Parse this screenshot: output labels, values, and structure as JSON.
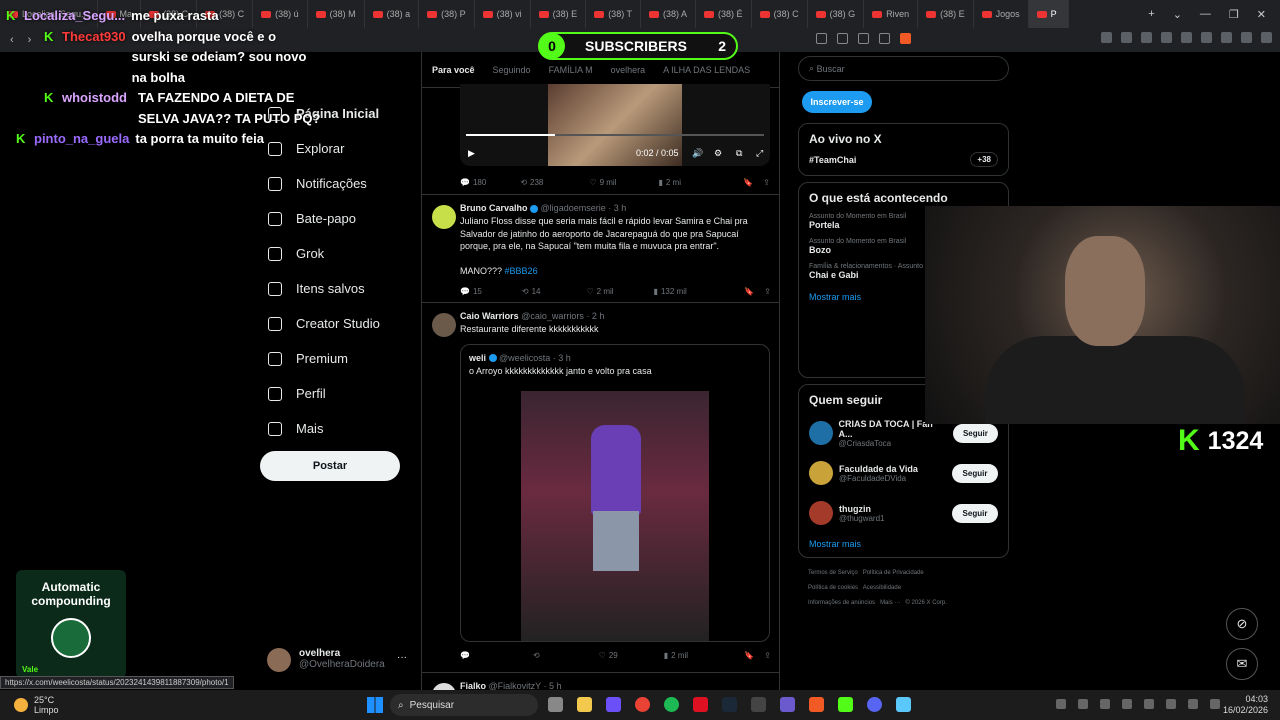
{
  "browser": {
    "tabs": [
      {
        "label": "Localiza_Segu...",
        "active": false
      },
      {
        "label": "Ma",
        "active": false
      },
      {
        "label": "(38) C",
        "active": false
      },
      {
        "label": "(38) C",
        "active": false
      },
      {
        "label": "(38) ú",
        "active": false
      },
      {
        "label": "(38) M",
        "active": false
      },
      {
        "label": "(38) a",
        "active": false
      },
      {
        "label": "(38) P",
        "active": false
      },
      {
        "label": "(38) vi",
        "active": false
      },
      {
        "label": "(38) E",
        "active": false
      },
      {
        "label": "(38) T",
        "active": false
      },
      {
        "label": "(38) A",
        "active": false
      },
      {
        "label": "(38) É",
        "active": false
      },
      {
        "label": "(38) C",
        "active": false
      },
      {
        "label": "(38) G",
        "active": false
      },
      {
        "label": "Riven",
        "active": false
      },
      {
        "label": "(38) E",
        "active": false
      },
      {
        "label": "Jogos",
        "active": false
      },
      {
        "label": "P",
        "active": true
      }
    ],
    "window_controls": [
      "+",
      "⌄",
      "—",
      "❐",
      "✕"
    ],
    "status_url": "https://x.com/weelicosta/status/2023241439811887309/photo/1"
  },
  "overlay": {
    "subscribers_count_left": "0",
    "subscribers_label": "SUBSCRIBERS",
    "subscribers_count_right": "2",
    "chat": [
      {
        "user": "Localiza_Segu...",
        "message": "me puxa rasta"
      },
      {
        "user": "Thecat930",
        "message": "ovelha porque você e o surski se odeiam? sou novo na bolha"
      },
      {
        "user": "whoistodd",
        "message": "TA FAZENDO A DIETA DE SELVA JAVA?? TA PUTO PQ?"
      },
      {
        "user": "pinto_na_guela",
        "message": "ta porra ta muito feia"
      }
    ],
    "kick_count": "1324",
    "promo_title": "Automatic compounding",
    "promo_vale": "Vale",
    "colors": {
      "kick_green": "#53fc18"
    }
  },
  "sidebar": {
    "items": [
      {
        "label": "Página Inicial",
        "icon": "home-icon"
      },
      {
        "label": "Explorar",
        "icon": "search-icon"
      },
      {
        "label": "Notificações",
        "icon": "bell-icon"
      },
      {
        "label": "Bate-papo",
        "icon": "mail-icon"
      },
      {
        "label": "Grok",
        "icon": "grok-icon"
      },
      {
        "label": "Itens salvos",
        "icon": "bookmark-icon"
      },
      {
        "label": "Creator Studio",
        "icon": "creator-icon"
      },
      {
        "label": "Premium",
        "icon": "x-logo-icon"
      },
      {
        "label": "Perfil",
        "icon": "person-icon"
      },
      {
        "label": "Mais",
        "icon": "more-icon"
      }
    ],
    "post_label": "Postar",
    "account": {
      "name": "ovelhera",
      "handle": "@OvelheraDoidera"
    }
  },
  "feed": {
    "tabs": [
      "Para você",
      "Seguindo",
      "FAMÍLIA M",
      "ovelhera",
      "A ILHA DAS LENDAS"
    ],
    "video": {
      "time": "0:02 / 0:05",
      "progress": 0.3
    },
    "video_actions": {
      "replies": "180",
      "reposts": "238",
      "likes": "9 mil",
      "views": "2 mi"
    },
    "tweets": [
      {
        "name": "Bruno Carvalho",
        "handle": "@ligadoemserie",
        "time": "3 h",
        "text": "Juliano Floss disse que seria mais fácil e rápido levar Samira e Chai pra Salvador de jatinho do aeroporto de Jacarepaguá do que pra Sapucaí porque, pra ele, na Sapucaí \"tem muita fila e muvuca pra entrar\".",
        "text2": "MANO???",
        "hashtag": "#BBB26",
        "replies": "15",
        "reposts": "14",
        "likes": "2 mil",
        "views": "132 mil"
      },
      {
        "name": "Caio Warriors",
        "handle": "@caio_warriors",
        "time": "2 h",
        "text": "Restaurante diferente kkkkkkkkkkk",
        "quote": {
          "name": "weli",
          "handle": "@weelicosta",
          "time": "3 h",
          "text": "o Arroyo kkkkkkkkkkkkk janto e volto pra casa"
        },
        "replies": "",
        "reposts": "",
        "likes": "29",
        "views": "2 mil"
      },
      {
        "name": "Fialko",
        "handle": "@FialkovitzY",
        "time": "5 h"
      }
    ]
  },
  "right": {
    "search_placeholder": "Buscar",
    "subscribe_label": "Inscrever-se",
    "live_title": "Ao vivo no X",
    "live_tag": "#TeamChai",
    "live_extra": "+38",
    "trending_title": "O que está acontecendo",
    "trends": [
      {
        "context": "Assunto do Momento em Brasil",
        "name": "Portela"
      },
      {
        "context": "Assunto do Momento em Brasil",
        "name": "Bozo"
      },
      {
        "context": "Família & relacionamentos · Assunto",
        "name": "Chai e Gabi"
      }
    ],
    "show_more": "Mostrar mais",
    "follow_title": "Quem seguir",
    "follow": [
      {
        "name": "CRIAS DA TOCA | Fan A...",
        "handle": "@CriasdaToca",
        "btn": "Seguir"
      },
      {
        "name": "Faculdade da Vida",
        "handle": "@FaculdadeDVida",
        "btn": "Seguir"
      },
      {
        "name": "thugzin",
        "handle": "@thugward1",
        "btn": "Seguir"
      }
    ],
    "footer_links": [
      "Termos de Serviço",
      "Política de Privacidade",
      "Política de cookies",
      "Acessibilidade",
      "Informações de anúncios",
      "Mais ···",
      "© 2026 X Corp."
    ]
  },
  "taskbar": {
    "weather_temp": "25°C",
    "weather_desc": "Limpo",
    "search": "Pesquisar",
    "time": "04:03",
    "date": "16/02/2026"
  }
}
